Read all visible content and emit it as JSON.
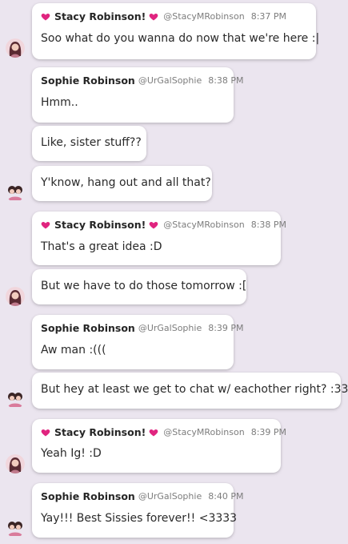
{
  "users": {
    "stacy": {
      "name": "Stacy Robinson!",
      "handle": "@StacyMRobinson"
    },
    "sophie": {
      "name": "Sophie Robinson",
      "handle": "@UrGalSophie"
    }
  },
  "messages": [
    {
      "time": "8:37 PM",
      "text": "Soo what do you wanna do now that we're here :|"
    },
    {
      "time": "8:38 PM",
      "text": "Hmm.."
    },
    {
      "text": "Like, sister stuff??"
    },
    {
      "text": "Y'know, hang out and all that?"
    },
    {
      "time": "8:38 PM",
      "text": "That's a great idea :D"
    },
    {
      "text": "But we have to do those tomorrow :["
    },
    {
      "time": "8:39 PM",
      "text": "Aw man :((("
    },
    {
      "text": "But hey at least we get to chat w/ eachother right? :33"
    },
    {
      "time": "8:39 PM",
      "text": "Yeah Ig! :D"
    },
    {
      "time": "8:40 PM",
      "text": "Yay!!! Best Sissies forever!! <3333"
    }
  ],
  "icons": {
    "heart": "heart-icon",
    "avatar_stacy": "avatar-stacy",
    "avatar_sophie": "avatar-sophie"
  },
  "colors": {
    "background": "#ebe5ef",
    "heart": "#e0247f",
    "bubble": "#ffffff"
  }
}
